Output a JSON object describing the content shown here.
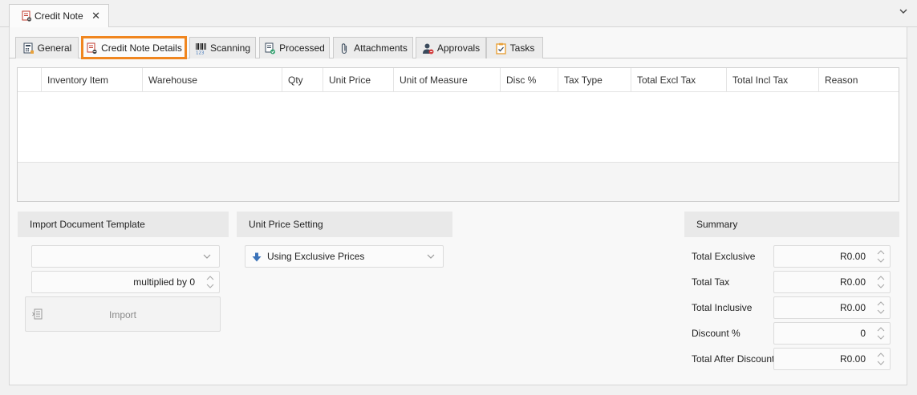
{
  "document_tab": {
    "label": "Credit Note",
    "close_glyph": "✕",
    "icon": "credit-note-icon"
  },
  "tabs": [
    {
      "label": "General",
      "icon": "calculator-icon"
    },
    {
      "label": "Credit Note Details",
      "icon": "credit-note-icon",
      "active": true
    },
    {
      "label": "Scanning",
      "icon": "barcode-icon"
    },
    {
      "label": "Processed",
      "icon": "processed-icon"
    },
    {
      "label": "Attachments",
      "icon": "paperclip-icon"
    },
    {
      "label": "Approvals",
      "icon": "approval-user-icon"
    },
    {
      "label": "Tasks",
      "icon": "task-clipboard-icon"
    }
  ],
  "grid": {
    "columns": [
      "Inventory Item",
      "Warehouse",
      "Qty",
      "Unit Price",
      "Unit of Measure",
      "Disc %",
      "Tax Type",
      "Total Excl Tax",
      "Total Incl Tax",
      "Reason"
    ],
    "rows": []
  },
  "import_template": {
    "title": "Import Document Template",
    "template_value": "",
    "multiplier_text": "multiplied by 0",
    "import_button": "Import"
  },
  "unit_price_setting": {
    "title": "Unit Price Setting",
    "selected": "Using Exclusive Prices"
  },
  "summary": {
    "title": "Summary",
    "total_exclusive": {
      "label": "Total Exclusive",
      "value": "R0.00"
    },
    "total_tax": {
      "label": "Total Tax",
      "value": "R0.00"
    },
    "total_inclusive": {
      "label": "Total Inclusive",
      "value": "R0.00"
    },
    "discount_pct": {
      "label": "Discount %",
      "value": "0"
    },
    "total_after_discount": {
      "label": "Total After Discount",
      "value": "R0.00"
    }
  },
  "colors": {
    "highlight": "#f0861f",
    "accent_blue": "#3b73b9"
  }
}
